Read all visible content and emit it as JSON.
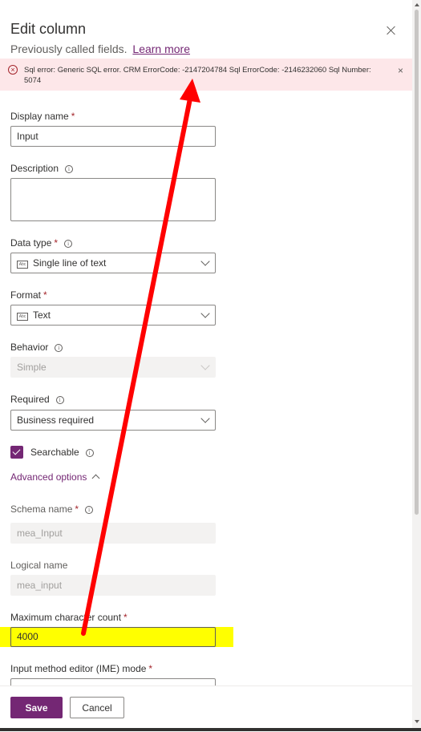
{
  "header": {
    "title": "Edit column",
    "subtitle": "Previously called fields.",
    "learn_more": "Learn more"
  },
  "error": {
    "message": "Sql error: Generic SQL error. CRM ErrorCode: -2147204784 Sql ErrorCode: -2146232060 Sql Number: 5074",
    "icon_symbol": "×",
    "close_symbol": "×"
  },
  "form": {
    "display_name": {
      "label": "Display name",
      "required": "*",
      "value": "Input"
    },
    "description": {
      "label": "Description",
      "value": ""
    },
    "data_type": {
      "label": "Data type",
      "required": "*",
      "value": "Single line of text"
    },
    "format": {
      "label": "Format",
      "required": "*",
      "value": "Text"
    },
    "behavior": {
      "label": "Behavior",
      "value": "Simple"
    },
    "required_field": {
      "label": "Required",
      "value": "Business required"
    },
    "searchable": {
      "label": "Searchable",
      "checked": true
    },
    "advanced_options": {
      "label": "Advanced options"
    },
    "schema_name": {
      "label": "Schema name",
      "required": "*",
      "value": "mea_Input"
    },
    "logical_name": {
      "label": "Logical name",
      "value": "mea_input"
    },
    "max_char_count": {
      "label": "Maximum character count",
      "required": "*",
      "value": "4000"
    },
    "ime_mode": {
      "label": "Input method editor (IME) mode",
      "required": "*"
    }
  },
  "footer": {
    "save_label": "Save",
    "cancel_label": "Cancel"
  },
  "icons": {
    "info": "i",
    "abc": "Abc"
  },
  "colors": {
    "accent": "#742774",
    "error_bg": "#fde7e9",
    "highlight": "#ffff00",
    "annotation_arrow": "#ff0000"
  }
}
